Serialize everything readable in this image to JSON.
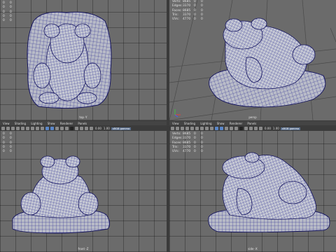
{
  "hud_labels": {
    "verts": "Verts:",
    "edges": "Edges:",
    "faces": "Faces:",
    "tris": "Tris:",
    "uvs": "UVs:"
  },
  "hud_values": {
    "verts": [
      "8685",
      "0",
      "0"
    ],
    "edges": [
      "3370",
      "0",
      "0"
    ],
    "faces": [
      "8685",
      "0",
      "0"
    ],
    "tris": [
      "3370",
      "0",
      "0"
    ],
    "uvs": [
      "4770",
      "0",
      "0"
    ]
  },
  "hud_top_left": {
    "col_a": [
      "0",
      "0",
      "0",
      "0",
      "0"
    ],
    "col_b": [
      "0",
      "0",
      "0",
      "0",
      "0"
    ]
  },
  "panel_menu": {
    "view": "View",
    "shading": "Shading",
    "lighting": "Lighting",
    "show": "Show",
    "renderer": "Renderer",
    "panels": "Panels"
  },
  "toolbar": {
    "value_a": "0.00",
    "value_b": "1.00",
    "color_space": "sRGB gamma"
  },
  "viewports": {
    "top_left": {
      "camera": "top -Y"
    },
    "top_right": {
      "camera": "persp"
    },
    "bottom_left": {
      "camera": "front -Z"
    },
    "bottom_right": {
      "camera": "side -X"
    }
  },
  "colors": {
    "viewport_bg": "#6b6b6b",
    "grid_line": "#4a4a4a",
    "wire": "#1e1e8a",
    "surface": "#b9bcc8",
    "panel": "#444444"
  }
}
